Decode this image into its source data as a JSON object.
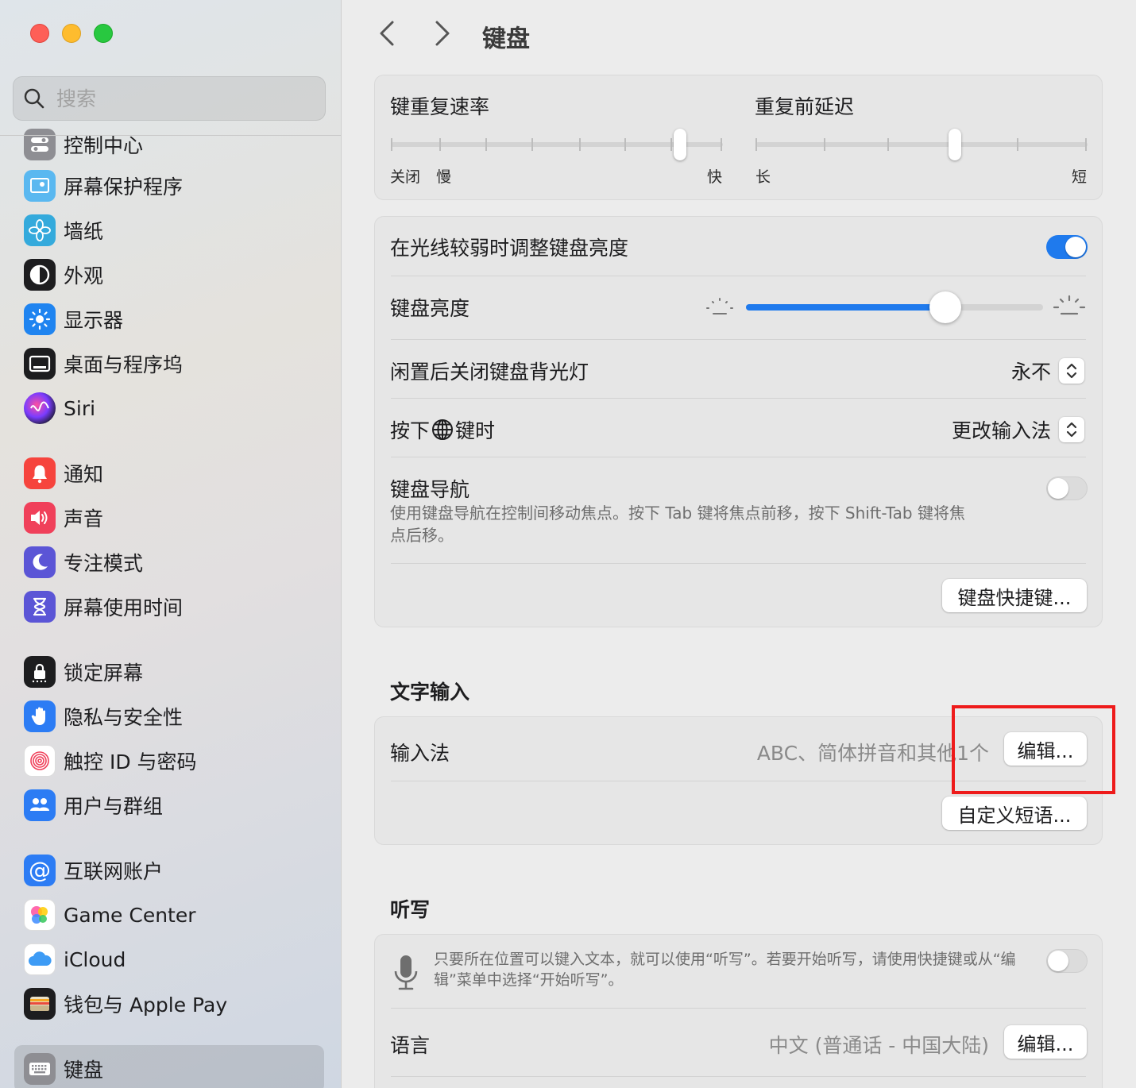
{
  "window": {
    "title": "键盘"
  },
  "search": {
    "placeholder": "搜索"
  },
  "sidebar": {
    "items": [
      {
        "label": "控制中心",
        "icon": "control-center-icon",
        "color": "#8e8e93"
      },
      {
        "label": "屏幕保护程序",
        "icon": "screen-saver-icon",
        "color": "#5ab8f0"
      },
      {
        "label": "墙纸",
        "icon": "wallpaper-icon",
        "color": "#34aadc"
      },
      {
        "label": "外观",
        "icon": "appearance-icon",
        "color": "#1d1d1f"
      },
      {
        "label": "显示器",
        "icon": "display-icon",
        "color": "#1f84f0"
      },
      {
        "label": "桌面与程序坞",
        "icon": "desktop-dock-icon",
        "color": "#1d1d1f"
      },
      {
        "label": "Siri",
        "icon": "siri-icon",
        "color": "#2b2b3a"
      },
      {
        "label": "通知",
        "icon": "notifications-icon",
        "color": "#f6443d"
      },
      {
        "label": "声音",
        "icon": "sound-icon",
        "color": "#f0405a"
      },
      {
        "label": "专注模式",
        "icon": "focus-icon",
        "color": "#5b55d6"
      },
      {
        "label": "屏幕使用时间",
        "icon": "screen-time-icon",
        "color": "#5b55d6"
      },
      {
        "label": "锁定屏幕",
        "icon": "lock-screen-icon",
        "color": "#1d1d1f"
      },
      {
        "label": "隐私与安全性",
        "icon": "privacy-hand-icon",
        "color": "#2c7cf4"
      },
      {
        "label": "触控 ID 与密码",
        "icon": "touch-id-icon",
        "color": "#ffffff"
      },
      {
        "label": "用户与群组",
        "icon": "users-groups-icon",
        "color": "#2c7cf4"
      },
      {
        "label": "互联网账户",
        "icon": "internet-accounts-icon",
        "color": "#2c7cf4"
      },
      {
        "label": "Game Center",
        "icon": "game-center-icon",
        "color": "#ffffff"
      },
      {
        "label": "iCloud",
        "icon": "icloud-icon",
        "color": "#ffffff"
      },
      {
        "label": "钱包与 Apple Pay",
        "icon": "wallet-icon",
        "color": "#1d1d1f"
      },
      {
        "label": "键盘",
        "icon": "keyboard-icon",
        "color": "#8e8e93",
        "selected": true
      }
    ]
  },
  "keyboard": {
    "repeat_rate": {
      "label": "键重复速率",
      "min_label": "关闭",
      "slow_label": "慢",
      "max_label": "快",
      "level": 0.87
    },
    "repeat_delay": {
      "label": "重复前延迟",
      "min_label": "长",
      "max_label": "短",
      "level": 0.6
    },
    "auto_brightness": {
      "label": "在光线较弱时调整键盘亮度",
      "on": true
    },
    "brightness": {
      "label": "键盘亮度",
      "level": 0.67
    },
    "backlight_off": {
      "label": "闲置后关闭键盘背光灯",
      "value": "永不"
    },
    "globe_key": {
      "label_before": "按下",
      "label_after": "键时",
      "value": "更改输入法"
    },
    "navigation": {
      "label": "键盘导航",
      "desc": "使用键盘导航在控制间移动焦点。按下 Tab 键将焦点前移，按下 Shift-Tab 键将焦点后移。",
      "on": false
    },
    "shortcuts_button": "键盘快捷键..."
  },
  "text_input": {
    "title": "文字输入",
    "input_sources": {
      "label": "输入法",
      "value": "ABC、简体拼音和其他1个",
      "edit_button": "编辑..."
    },
    "replacements_button": "自定义短语..."
  },
  "dictation": {
    "title": "听写",
    "desc": "只要所在位置可以键入文本，就可以使用“听写”。若要开始听写，请使用快捷键或从“编辑”菜单中选择“开始听写”。",
    "on": false,
    "language": {
      "label": "语言",
      "value": "中文 (普通话 - 中国大陆)",
      "edit_button": "编辑..."
    }
  },
  "colors": {
    "accent": "#1f7aed",
    "highlight": "#ee1b1b"
  }
}
